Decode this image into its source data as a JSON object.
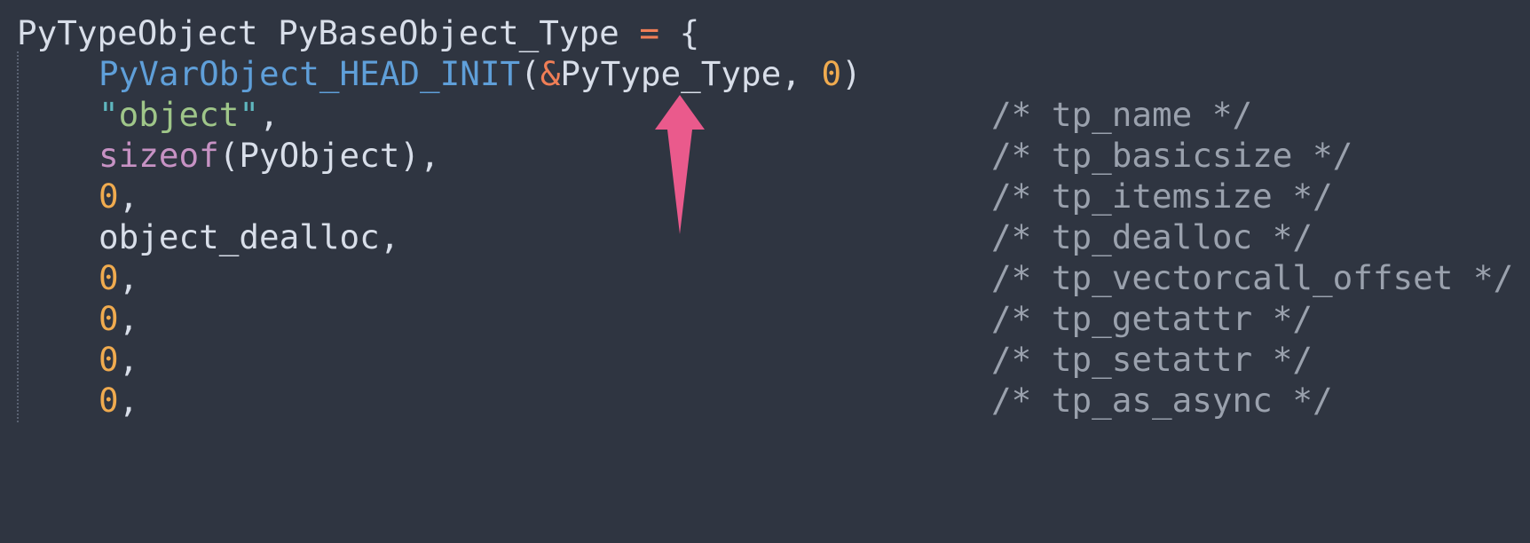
{
  "code": {
    "line1": {
      "type": "PyTypeObject",
      "name": "PyBaseObject_Type",
      "eq": "=",
      "brace": "{"
    },
    "line2": {
      "macro": "PyVarObject_HEAD_INIT",
      "open": "(",
      "amp": "&",
      "arg": "PyType_Type",
      "comma": ", ",
      "zero": "0",
      "close": ")"
    },
    "line3": {
      "open_quote": "\"",
      "str": "object",
      "close_quote": "\"",
      "comma": ",",
      "comment": "/* tp_name */"
    },
    "line4": {
      "fn": "sizeof",
      "arg": "(PyObject)",
      "comma": ",",
      "comment": "/* tp_basicsize */"
    },
    "line5": {
      "zero": "0",
      "comma": ",",
      "comment": "/* tp_itemsize */"
    },
    "line6": {
      "value": "object_dealloc",
      "comma": ",",
      "comment": "/* tp_dealloc */"
    },
    "line7": {
      "zero": "0",
      "comma": ",",
      "comment": "/* tp_vectorcall_offset */"
    },
    "line8": {
      "zero": "0",
      "comma": ",",
      "comment": "/* tp_getattr */"
    },
    "line9": {
      "zero": "0",
      "comma": ",",
      "comment": "/* tp_setattr */"
    },
    "line10": {
      "zero": "0",
      "comma": ",",
      "comment": "/* tp_as_async */"
    }
  },
  "colors": {
    "background": "#2f3541",
    "text": "#d8dee9",
    "operator": "#f07e56",
    "macro": "#5f9fd9",
    "number": "#f0ab4f",
    "string": "#9fc689",
    "keyword_fn": "#c792c4",
    "comment": "#9aa1ad",
    "annotation_arrow": "#ea5a8c"
  },
  "annotation": {
    "icon": "pink-up-arrow-icon"
  }
}
